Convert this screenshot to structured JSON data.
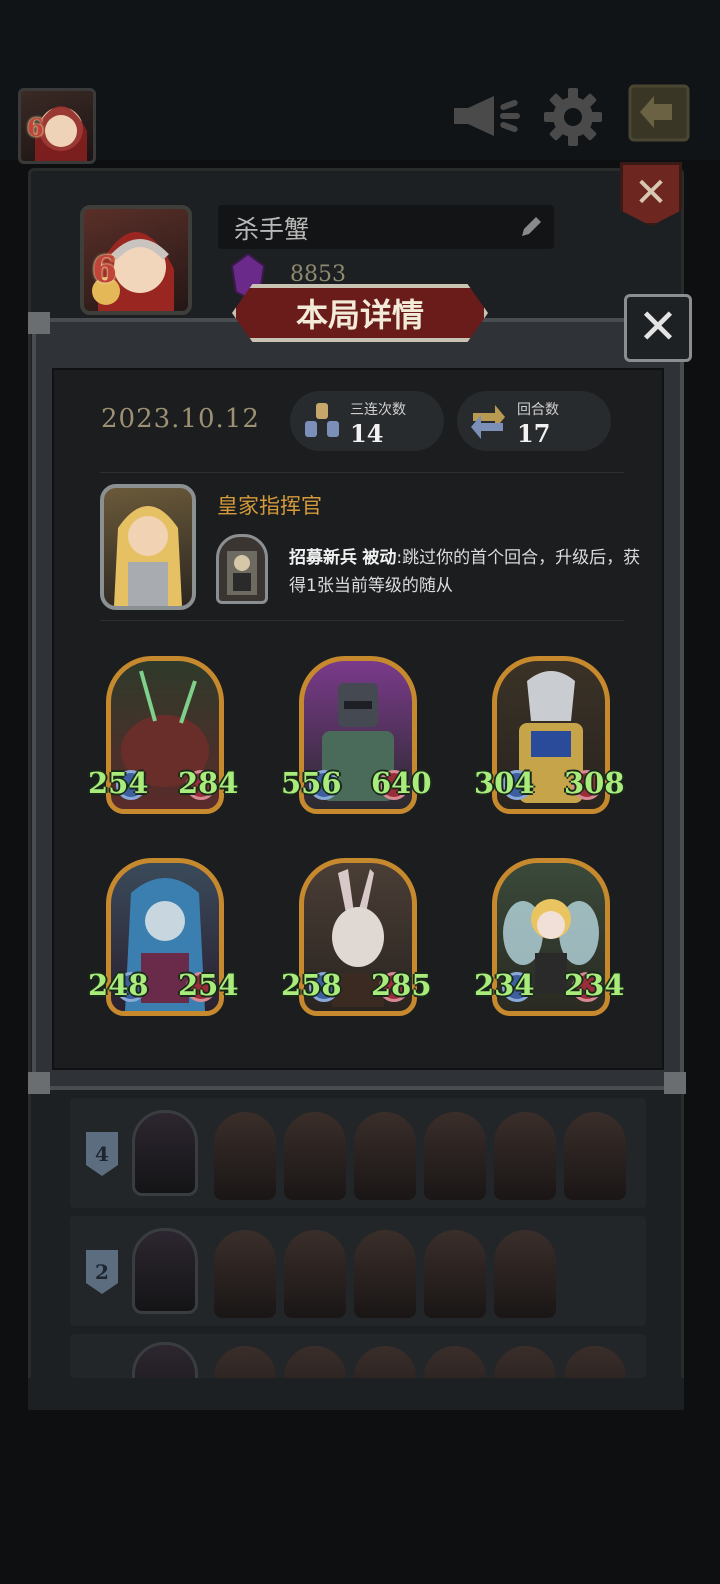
{
  "topbar": {
    "avatar_level": "6",
    "icons": [
      "megaphone-icon",
      "gear-icon",
      "exit-icon"
    ]
  },
  "profile": {
    "level": "6",
    "name": "杀手蟹",
    "score": "8853"
  },
  "modal": {
    "title": "本局详情",
    "date": "2023.10.12",
    "stats": [
      {
        "label": "三连次数",
        "value": "14"
      },
      {
        "label": "回合数",
        "value": "17"
      }
    ],
    "hero": {
      "name": "皇家指挥官",
      "skill_name": "招募新兵",
      "skill_type": "被动",
      "skill_desc": ":跳过你的首个回合，升级后，获得1张当前等级的随从"
    },
    "units": [
      {
        "attack": "254",
        "health": "284",
        "color": "#5a2b2a"
      },
      {
        "attack": "556",
        "health": "640",
        "color": "#6a2f78"
      },
      {
        "attack": "304",
        "health": "308",
        "color": "#3c2f22"
      },
      {
        "attack": "248",
        "health": "254",
        "color": "#2b3a4a"
      },
      {
        "attack": "258",
        "health": "285",
        "color": "#3a3430"
      },
      {
        "attack": "234",
        "health": "234",
        "color": "#4a5a3a"
      }
    ]
  },
  "history": [
    {
      "rank": "4"
    },
    {
      "rank": "2"
    }
  ]
}
